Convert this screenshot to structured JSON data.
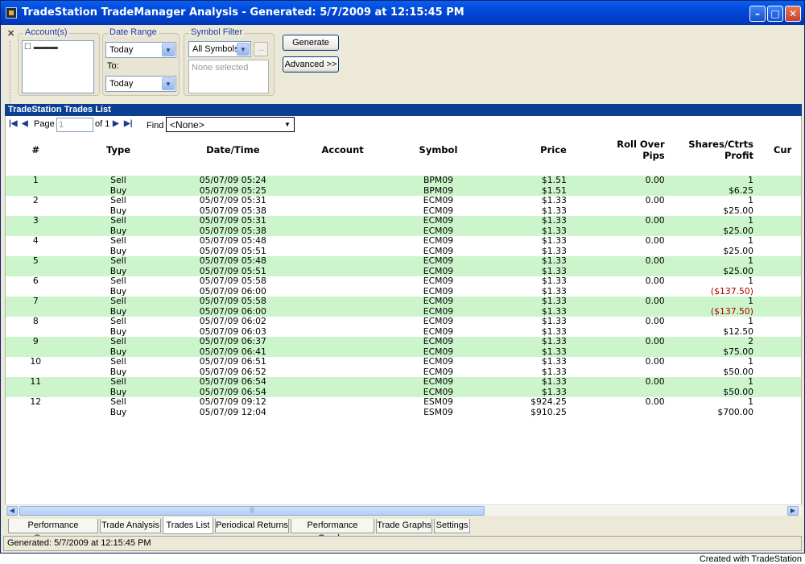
{
  "window": {
    "title": "TradeStation TradeManager Analysis - Generated: 5/7/2009 at 12:15:45 PM"
  },
  "toolbar": {
    "accounts_label": "Account(s)",
    "date_range_label": "Date Range",
    "date_from": "Today",
    "to_label": "To:",
    "date_to": "Today",
    "symbol_filter_label": "Symbol Filter",
    "symbol_filter": "All Symbols",
    "ellipsis": "...",
    "none_selected": "None selected",
    "generate": "Generate",
    "advanced": "Advanced >>"
  },
  "section_title": "TradeStation Trades List",
  "pager": {
    "page_label": "Page",
    "page_value": "1",
    "of_label": "of 1",
    "find_label": "Find",
    "find_value": "<None>"
  },
  "columns": {
    "num": "#",
    "type": "Type",
    "date": "Date/Time",
    "account": "Account",
    "symbol": "Symbol",
    "price": "Price",
    "roll1": "Roll Over",
    "roll2": "Pips",
    "prof1": "Shares/Ctrts",
    "prof2": "Profit",
    "cur": "Cur"
  },
  "rows": [
    {
      "num": "1",
      "type": "Sell",
      "date": "05/07/09 05:24",
      "symbol": "BPM09",
      "price": "$1.51",
      "roll": "0.00",
      "shares": "1",
      "green": true
    },
    {
      "type": "Buy",
      "date": "05/07/09 05:25",
      "symbol": "BPM09",
      "price": "$1.51",
      "profit": "$6.25",
      "green": true
    },
    {
      "num": "2",
      "type": "Sell",
      "date": "05/07/09 05:31",
      "symbol": "ECM09",
      "price": "$1.33",
      "roll": "0.00",
      "shares": "1",
      "green": false
    },
    {
      "type": "Buy",
      "date": "05/07/09 05:38",
      "symbol": "ECM09",
      "price": "$1.33",
      "profit": "$25.00",
      "green": false
    },
    {
      "num": "3",
      "type": "Sell",
      "date": "05/07/09 05:31",
      "symbol": "ECM09",
      "price": "$1.33",
      "roll": "0.00",
      "shares": "1",
      "green": true
    },
    {
      "type": "Buy",
      "date": "05/07/09 05:38",
      "symbol": "ECM09",
      "price": "$1.33",
      "profit": "$25.00",
      "green": true
    },
    {
      "num": "4",
      "type": "Sell",
      "date": "05/07/09 05:48",
      "symbol": "ECM09",
      "price": "$1.33",
      "roll": "0.00",
      "shares": "1",
      "green": false
    },
    {
      "type": "Buy",
      "date": "05/07/09 05:51",
      "symbol": "ECM09",
      "price": "$1.33",
      "profit": "$25.00",
      "green": false
    },
    {
      "num": "5",
      "type": "Sell",
      "date": "05/07/09 05:48",
      "symbol": "ECM09",
      "price": "$1.33",
      "roll": "0.00",
      "shares": "1",
      "green": true
    },
    {
      "type": "Buy",
      "date": "05/07/09 05:51",
      "symbol": "ECM09",
      "price": "$1.33",
      "profit": "$25.00",
      "green": true
    },
    {
      "num": "6",
      "type": "Sell",
      "date": "05/07/09 05:58",
      "symbol": "ECM09",
      "price": "$1.33",
      "roll": "0.00",
      "shares": "1",
      "green": false
    },
    {
      "type": "Buy",
      "date": "05/07/09 06:00",
      "symbol": "ECM09",
      "price": "$1.33",
      "profit": "($137.50)",
      "neg": true,
      "green": false
    },
    {
      "num": "7",
      "type": "Sell",
      "date": "05/07/09 05:58",
      "symbol": "ECM09",
      "price": "$1.33",
      "roll": "0.00",
      "shares": "1",
      "green": true
    },
    {
      "type": "Buy",
      "date": "05/07/09 06:00",
      "symbol": "ECM09",
      "price": "$1.33",
      "profit": "($137.50)",
      "neg": true,
      "green": true
    },
    {
      "num": "8",
      "type": "Sell",
      "date": "05/07/09 06:02",
      "symbol": "ECM09",
      "price": "$1.33",
      "roll": "0.00",
      "shares": "1",
      "green": false
    },
    {
      "type": "Buy",
      "date": "05/07/09 06:03",
      "symbol": "ECM09",
      "price": "$1.33",
      "profit": "$12.50",
      "green": false
    },
    {
      "num": "9",
      "type": "Sell",
      "date": "05/07/09 06:37",
      "symbol": "ECM09",
      "price": "$1.33",
      "roll": "0.00",
      "shares": "2",
      "green": true
    },
    {
      "type": "Buy",
      "date": "05/07/09 06:41",
      "symbol": "ECM09",
      "price": "$1.33",
      "profit": "$75.00",
      "green": true
    },
    {
      "num": "10",
      "type": "Sell",
      "date": "05/07/09 06:51",
      "symbol": "ECM09",
      "price": "$1.33",
      "roll": "0.00",
      "shares": "1",
      "green": false
    },
    {
      "type": "Buy",
      "date": "05/07/09 06:52",
      "symbol": "ECM09",
      "price": "$1.33",
      "profit": "$50.00",
      "green": false
    },
    {
      "num": "11",
      "type": "Sell",
      "date": "05/07/09 06:54",
      "symbol": "ECM09",
      "price": "$1.33",
      "roll": "0.00",
      "shares": "1",
      "green": true
    },
    {
      "type": "Buy",
      "date": "05/07/09 06:54",
      "symbol": "ECM09",
      "price": "$1.33",
      "profit": "$50.00",
      "green": true
    },
    {
      "num": "12",
      "type": "Sell",
      "date": "05/07/09 09:12",
      "symbol": "ESM09",
      "price": "$924.25",
      "roll": "0.00",
      "shares": "1",
      "green": false
    },
    {
      "type": "Buy",
      "date": "05/07/09 12:04",
      "symbol": "ESM09",
      "price": "$910.25",
      "profit": "$700.00",
      "green": false
    }
  ],
  "tabs": [
    "Performance Summary",
    "Trade Analysis",
    "Trades List",
    "Periodical Returns",
    "Performance Graphs",
    "Trade Graphs",
    "Settings"
  ],
  "active_tab": "Trades List",
  "status": "Generated: 5/7/2009 at 12:15:45 PM",
  "footer": "Created with TradeStation",
  "colors": {
    "green_row": "#ccf5cc",
    "title_bar": "#0049d8",
    "section_bar": "#0a3f94",
    "negative": "#b00000"
  }
}
